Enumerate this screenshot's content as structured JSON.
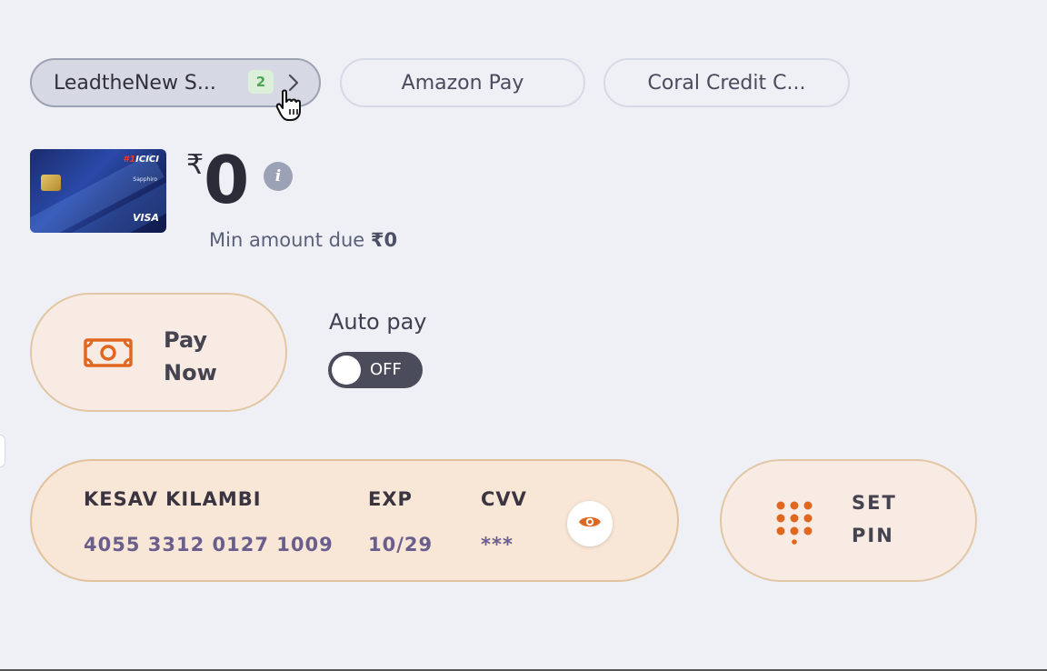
{
  "tabs": [
    {
      "label": "LeadtheNew S...",
      "badge": "2",
      "active": true
    },
    {
      "label": "Amazon Pay",
      "active": false
    },
    {
      "label": "Coral Credit C...",
      "active": false
    }
  ],
  "card_image": {
    "brand": "ICICI",
    "brand_prefix": "#1",
    "sub": "Sapphiro",
    "network": "VISA"
  },
  "balance": {
    "currency": "₹",
    "amount": "0",
    "min_due_label": "Min amount due ",
    "min_due_value": "₹0"
  },
  "actions": {
    "pay_now_label": "Pay Now",
    "autopay_label": "Auto pay",
    "autopay_state": "OFF",
    "set_pin_label": "SET PIN"
  },
  "card_details": {
    "name": "KESAV KILAMBI",
    "number": "4055 3312 0127 1009",
    "exp_label": "EXP",
    "exp_value": "10/29",
    "cvv_label": "CVV",
    "cvv_value": "***"
  },
  "colors": {
    "accent": "#e0671f",
    "pill_bg": "#f8e6d6",
    "toggle_bg": "#4a4c5c"
  },
  "icons": [
    "chevron-right-icon",
    "hand-cursor-icon",
    "info-icon",
    "cash-icon",
    "eye-icon",
    "keypad-icon"
  ]
}
